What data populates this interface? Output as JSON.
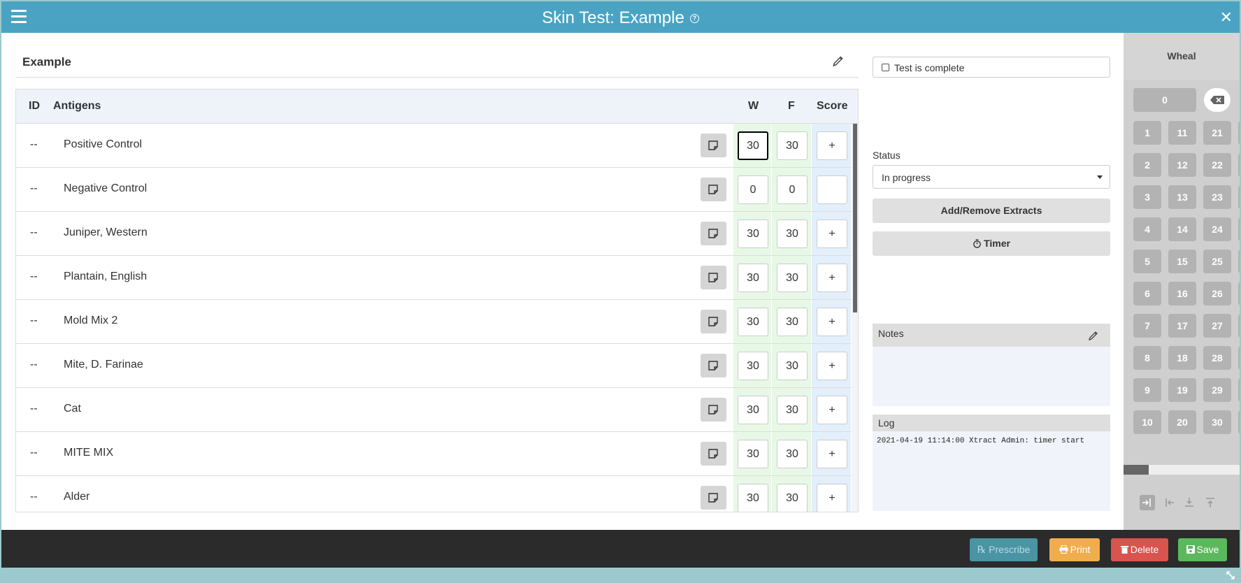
{
  "window": {
    "title": "Skin Test: Example",
    "close_glyph": "✕"
  },
  "card": {
    "name": "Example"
  },
  "table": {
    "headers": {
      "id": "ID",
      "antigens": "Antigens",
      "w": "W",
      "f": "F",
      "score": "Score"
    },
    "rows": [
      {
        "id": "--",
        "antigen": "Positive Control",
        "w": "30",
        "f": "30",
        "score": "+"
      },
      {
        "id": "--",
        "antigen": "Negative Control",
        "w": "0",
        "f": "0",
        "score": ""
      },
      {
        "id": "--",
        "antigen": "Juniper, Western",
        "w": "30",
        "f": "30",
        "score": "+"
      },
      {
        "id": "--",
        "antigen": "Plantain, English",
        "w": "30",
        "f": "30",
        "score": "+"
      },
      {
        "id": "--",
        "antigen": "Mold Mix 2",
        "w": "30",
        "f": "30",
        "score": "+"
      },
      {
        "id": "--",
        "antigen": "Mite, D. Farinae",
        "w": "30",
        "f": "30",
        "score": "+"
      },
      {
        "id": "--",
        "antigen": "Cat",
        "w": "30",
        "f": "30",
        "score": "+"
      },
      {
        "id": "--",
        "antigen": "MITE MIX",
        "w": "30",
        "f": "30",
        "score": "+"
      },
      {
        "id": "--",
        "antigen": "Alder",
        "w": "30",
        "f": "30",
        "score": "+"
      }
    ]
  },
  "side": {
    "complete_label": "Test is complete",
    "status_label": "Status",
    "status_value": "In progress",
    "add_remove_label": "Add/Remove Extracts",
    "timer_label": "Timer",
    "notes_label": "Notes",
    "log_label": "Log",
    "log_entries": [
      "2021-04-19 11:14:00 Xtract Admin: timer start"
    ]
  },
  "keypad": {
    "header": "Wheal",
    "display": "0",
    "keys": [
      [
        "1",
        "11",
        "21"
      ],
      [
        "2",
        "12",
        "22"
      ],
      [
        "3",
        "13",
        "23"
      ],
      [
        "4",
        "14",
        "24"
      ],
      [
        "5",
        "15",
        "25"
      ],
      [
        "6",
        "16",
        "26"
      ],
      [
        "7",
        "17",
        "27"
      ],
      [
        "8",
        "18",
        "28"
      ],
      [
        "9",
        "19",
        "29"
      ],
      [
        "10",
        "20",
        "30"
      ]
    ]
  },
  "footer": {
    "prescribe": "Prescribe",
    "print": "Print",
    "delete": "Delete",
    "save": "Save"
  },
  "colors": {
    "header": "#4aa3c3",
    "prescribe": "#4a94a4",
    "print": "#f0ad4e",
    "delete": "#d9534f",
    "save": "#5cb85c",
    "footer": "#2b2b2b"
  }
}
